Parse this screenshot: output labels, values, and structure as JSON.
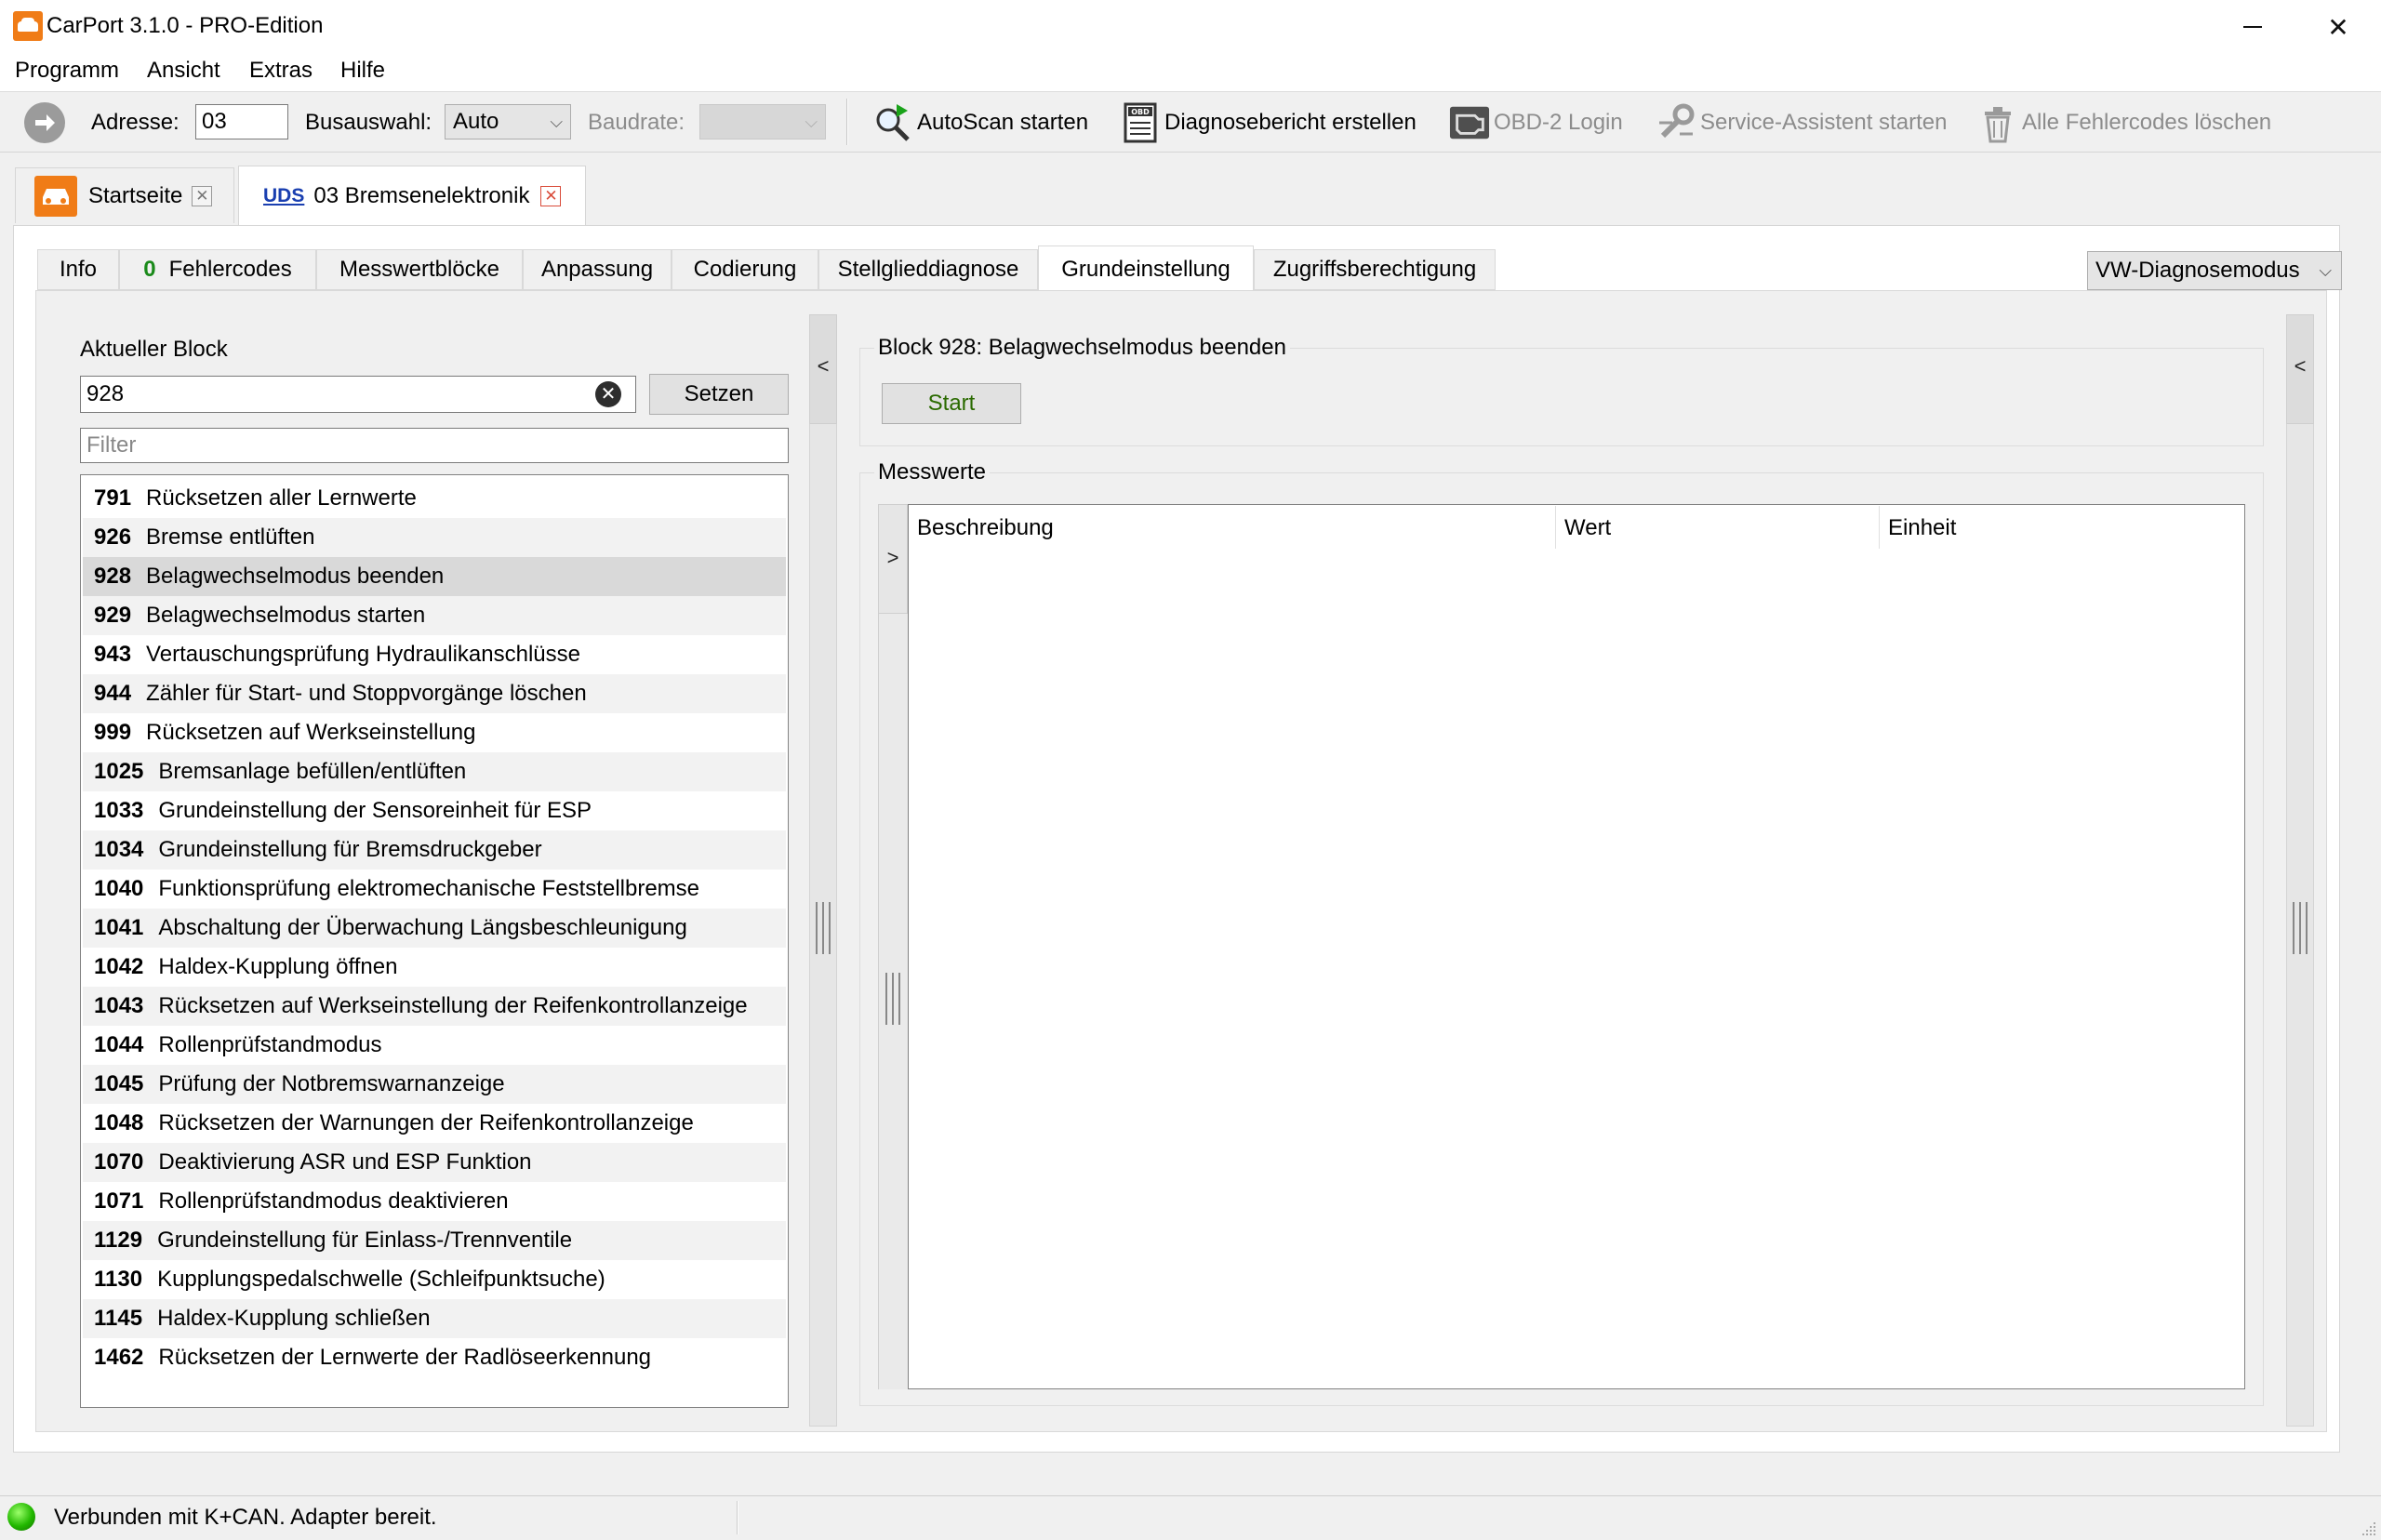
{
  "window": {
    "title": "CarPort 3.1.0 - PRO-Edition",
    "minimize": "—",
    "maximize": "☐",
    "close": "✕"
  },
  "menu": [
    "Programm",
    "Ansicht",
    "Extras",
    "Hilfe"
  ],
  "toolbar": {
    "address_label": "Adresse:",
    "address_value": "03",
    "bus_label": "Busauswahl:",
    "bus_value": "Auto",
    "baud_label": "Baudrate:",
    "baud_value": "",
    "autoscan": "AutoScan starten",
    "report": "Diagnosebericht erstellen",
    "report_icon_text": "OBD",
    "obd_login": "OBD-2 Login",
    "service": "Service-Assistent starten",
    "clear_codes": "Alle Fehlercodes löschen"
  },
  "doc_tabs": {
    "home": "Startseite",
    "uds_tag": "UDS",
    "module": "03 Bremsenelektronik",
    "close": "✕"
  },
  "func_tabs": {
    "info": "Info",
    "fault_count": "0",
    "faults": "Fehlercodes",
    "mwb": "Messwertblöcke",
    "adapt": "Anpassung",
    "coding": "Codierung",
    "actuator": "Stellglieddiagnose",
    "basic": "Grundeinstellung",
    "access": "Zugriffsberechtigung"
  },
  "diag_mode": "VW-Diagnosemodus",
  "left": {
    "block_label": "Aktueller Block",
    "block_value": "928",
    "clear": "✕",
    "set_button": "Setzen",
    "filter_placeholder": "Filter",
    "items": [
      {
        "num": "791",
        "text": "Rücksetzen aller Lernwerte"
      },
      {
        "num": "926",
        "text": "Bremse entlüften"
      },
      {
        "num": "928",
        "text": "Belagwechselmodus beenden"
      },
      {
        "num": "929",
        "text": "Belagwechselmodus starten"
      },
      {
        "num": "943",
        "text": "Vertauschungsprüfung Hydraulikanschlüsse"
      },
      {
        "num": "944",
        "text": "Zähler für Start- und Stoppvorgänge löschen"
      },
      {
        "num": "999",
        "text": "Rücksetzen auf Werkseinstellung"
      },
      {
        "num": "1025",
        "text": "Bremsanlage befüllen/entlüften"
      },
      {
        "num": "1033",
        "text": "Grundeinstellung der Sensoreinheit für ESP"
      },
      {
        "num": "1034",
        "text": "Grundeinstellung für Bremsdruckgeber"
      },
      {
        "num": "1040",
        "text": "Funktionsprüfung elektromechanische Feststellbremse"
      },
      {
        "num": "1041",
        "text": "Abschaltung der Überwachung Längsbeschleunigung"
      },
      {
        "num": "1042",
        "text": "Haldex-Kupplung öffnen"
      },
      {
        "num": "1043",
        "text": "Rücksetzen auf Werkseinstellung der Reifenkontrollanzeige"
      },
      {
        "num": "1044",
        "text": "Rollenprüfstandmodus"
      },
      {
        "num": "1045",
        "text": "Prüfung der Notbremswarnanzeige"
      },
      {
        "num": "1048",
        "text": "Rücksetzen der Warnungen der Reifenkontrollanzeige"
      },
      {
        "num": "1070",
        "text": "Deaktivierung ASR und ESP Funktion"
      },
      {
        "num": "1071",
        "text": "Rollenprüfstandmodus deaktivieren"
      },
      {
        "num": "1129",
        "text": "Grundeinstellung für Einlass-/Trennventile"
      },
      {
        "num": "1130",
        "text": "Kupplungspedalschwelle (Schleifpunktsuche)"
      },
      {
        "num": "1145",
        "text": "Haldex-Kupplung schließen"
      },
      {
        "num": "1462",
        "text": "Rücksetzen der Lernwerte der Radlöseerkennung"
      }
    ]
  },
  "splitters": {
    "collapse": "<",
    "expand": ">"
  },
  "right": {
    "block_title": "Block 928: Belagwechselmodus beenden",
    "start_button": "Start",
    "values_title": "Messwerte",
    "columns": [
      "Beschreibung",
      "Wert",
      "Einheit"
    ]
  },
  "status": {
    "text": "Verbunden mit K+CAN. Adapter bereit.",
    "led_color": "#22b800"
  },
  "colors": {
    "accent": "#f07c17",
    "uds_link": "#1a3fb0",
    "fault_count": "#1a8a1a",
    "close_red": "#d94b3a"
  }
}
